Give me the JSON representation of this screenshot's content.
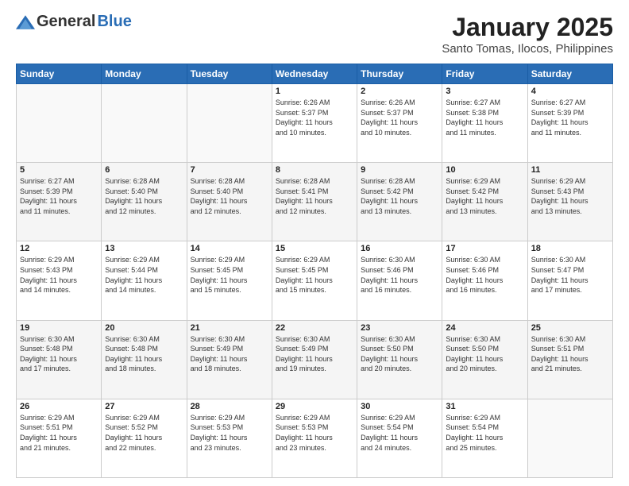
{
  "header": {
    "logo_general": "General",
    "logo_blue": "Blue",
    "month_title": "January 2025",
    "location": "Santo Tomas, Ilocos, Philippines"
  },
  "weekdays": [
    "Sunday",
    "Monday",
    "Tuesday",
    "Wednesday",
    "Thursday",
    "Friday",
    "Saturday"
  ],
  "weeks": [
    [
      {
        "day": "",
        "info": ""
      },
      {
        "day": "",
        "info": ""
      },
      {
        "day": "",
        "info": ""
      },
      {
        "day": "1",
        "info": "Sunrise: 6:26 AM\nSunset: 5:37 PM\nDaylight: 11 hours\nand 10 minutes."
      },
      {
        "day": "2",
        "info": "Sunrise: 6:26 AM\nSunset: 5:37 PM\nDaylight: 11 hours\nand 10 minutes."
      },
      {
        "day": "3",
        "info": "Sunrise: 6:27 AM\nSunset: 5:38 PM\nDaylight: 11 hours\nand 11 minutes."
      },
      {
        "day": "4",
        "info": "Sunrise: 6:27 AM\nSunset: 5:39 PM\nDaylight: 11 hours\nand 11 minutes."
      }
    ],
    [
      {
        "day": "5",
        "info": "Sunrise: 6:27 AM\nSunset: 5:39 PM\nDaylight: 11 hours\nand 11 minutes."
      },
      {
        "day": "6",
        "info": "Sunrise: 6:28 AM\nSunset: 5:40 PM\nDaylight: 11 hours\nand 12 minutes."
      },
      {
        "day": "7",
        "info": "Sunrise: 6:28 AM\nSunset: 5:40 PM\nDaylight: 11 hours\nand 12 minutes."
      },
      {
        "day": "8",
        "info": "Sunrise: 6:28 AM\nSunset: 5:41 PM\nDaylight: 11 hours\nand 12 minutes."
      },
      {
        "day": "9",
        "info": "Sunrise: 6:28 AM\nSunset: 5:42 PM\nDaylight: 11 hours\nand 13 minutes."
      },
      {
        "day": "10",
        "info": "Sunrise: 6:29 AM\nSunset: 5:42 PM\nDaylight: 11 hours\nand 13 minutes."
      },
      {
        "day": "11",
        "info": "Sunrise: 6:29 AM\nSunset: 5:43 PM\nDaylight: 11 hours\nand 13 minutes."
      }
    ],
    [
      {
        "day": "12",
        "info": "Sunrise: 6:29 AM\nSunset: 5:43 PM\nDaylight: 11 hours\nand 14 minutes."
      },
      {
        "day": "13",
        "info": "Sunrise: 6:29 AM\nSunset: 5:44 PM\nDaylight: 11 hours\nand 14 minutes."
      },
      {
        "day": "14",
        "info": "Sunrise: 6:29 AM\nSunset: 5:45 PM\nDaylight: 11 hours\nand 15 minutes."
      },
      {
        "day": "15",
        "info": "Sunrise: 6:29 AM\nSunset: 5:45 PM\nDaylight: 11 hours\nand 15 minutes."
      },
      {
        "day": "16",
        "info": "Sunrise: 6:30 AM\nSunset: 5:46 PM\nDaylight: 11 hours\nand 16 minutes."
      },
      {
        "day": "17",
        "info": "Sunrise: 6:30 AM\nSunset: 5:46 PM\nDaylight: 11 hours\nand 16 minutes."
      },
      {
        "day": "18",
        "info": "Sunrise: 6:30 AM\nSunset: 5:47 PM\nDaylight: 11 hours\nand 17 minutes."
      }
    ],
    [
      {
        "day": "19",
        "info": "Sunrise: 6:30 AM\nSunset: 5:48 PM\nDaylight: 11 hours\nand 17 minutes."
      },
      {
        "day": "20",
        "info": "Sunrise: 6:30 AM\nSunset: 5:48 PM\nDaylight: 11 hours\nand 18 minutes."
      },
      {
        "day": "21",
        "info": "Sunrise: 6:30 AM\nSunset: 5:49 PM\nDaylight: 11 hours\nand 18 minutes."
      },
      {
        "day": "22",
        "info": "Sunrise: 6:30 AM\nSunset: 5:49 PM\nDaylight: 11 hours\nand 19 minutes."
      },
      {
        "day": "23",
        "info": "Sunrise: 6:30 AM\nSunset: 5:50 PM\nDaylight: 11 hours\nand 20 minutes."
      },
      {
        "day": "24",
        "info": "Sunrise: 6:30 AM\nSunset: 5:50 PM\nDaylight: 11 hours\nand 20 minutes."
      },
      {
        "day": "25",
        "info": "Sunrise: 6:30 AM\nSunset: 5:51 PM\nDaylight: 11 hours\nand 21 minutes."
      }
    ],
    [
      {
        "day": "26",
        "info": "Sunrise: 6:29 AM\nSunset: 5:51 PM\nDaylight: 11 hours\nand 21 minutes."
      },
      {
        "day": "27",
        "info": "Sunrise: 6:29 AM\nSunset: 5:52 PM\nDaylight: 11 hours\nand 22 minutes."
      },
      {
        "day": "28",
        "info": "Sunrise: 6:29 AM\nSunset: 5:53 PM\nDaylight: 11 hours\nand 23 minutes."
      },
      {
        "day": "29",
        "info": "Sunrise: 6:29 AM\nSunset: 5:53 PM\nDaylight: 11 hours\nand 23 minutes."
      },
      {
        "day": "30",
        "info": "Sunrise: 6:29 AM\nSunset: 5:54 PM\nDaylight: 11 hours\nand 24 minutes."
      },
      {
        "day": "31",
        "info": "Sunrise: 6:29 AM\nSunset: 5:54 PM\nDaylight: 11 hours\nand 25 minutes."
      },
      {
        "day": "",
        "info": ""
      }
    ]
  ]
}
